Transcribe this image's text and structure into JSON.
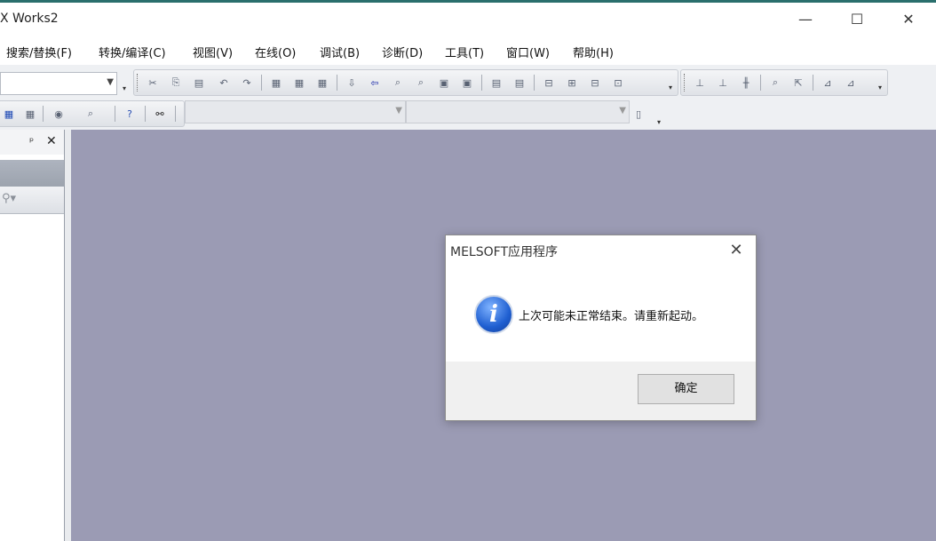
{
  "window": {
    "title": "X Works2",
    "controls": {
      "minimize": "—",
      "maximize": "☐",
      "close": "✕"
    }
  },
  "menu": [
    {
      "label": "搜索/替换(F)"
    },
    {
      "label": "转换/编译(C)"
    },
    {
      "label": "视图(V)"
    },
    {
      "label": "在线(O)"
    },
    {
      "label": "调试(B)"
    },
    {
      "label": "诊断(D)"
    },
    {
      "label": "工具(T)"
    },
    {
      "label": "窗口(W)"
    },
    {
      "label": "帮助(H)"
    }
  ],
  "toolbar": {
    "row1_icons": [
      "dropdown-combo",
      "cut-icon",
      "copy-icon",
      "paste-icon",
      "undo-icon",
      "redo-icon",
      "device-search-icon",
      "device-replace-icon",
      "instruction-search-icon",
      "read-plc-icon",
      "write-plc-icon",
      "verify-icon",
      "monitor-icon",
      "monitor-start-icon",
      "monitor-stop-icon",
      "device-batch-icon",
      "device-register-icon",
      "watch-icon",
      "watch2-icon",
      "ladder-icon",
      "ladder2-icon",
      "ladder3-icon",
      "ladder4-icon",
      "step-icon",
      "step2-icon",
      "step3-icon"
    ],
    "row2_icons": [
      "device-memory-icon",
      "device-list-icon",
      "watch-eye-icon",
      "search-icon",
      "help-icon",
      "binoculars-icon"
    ],
    "combo1_value": "",
    "combo2_value": "",
    "combo3_value": ""
  },
  "navigation_panel": {
    "pin": "ᵖ",
    "close": "✕"
  },
  "dialog": {
    "title": "MELSOFT应用程序",
    "close": "✕",
    "icon": "info-icon",
    "icon_glyph": "i",
    "message": "上次可能未正常结束。请重新起动。",
    "ok_label": "确定"
  },
  "colors": {
    "workspace": "#9b9bb4",
    "taskbar_strip": "#2a6f6d",
    "info_blue": "#1f5fd1"
  }
}
